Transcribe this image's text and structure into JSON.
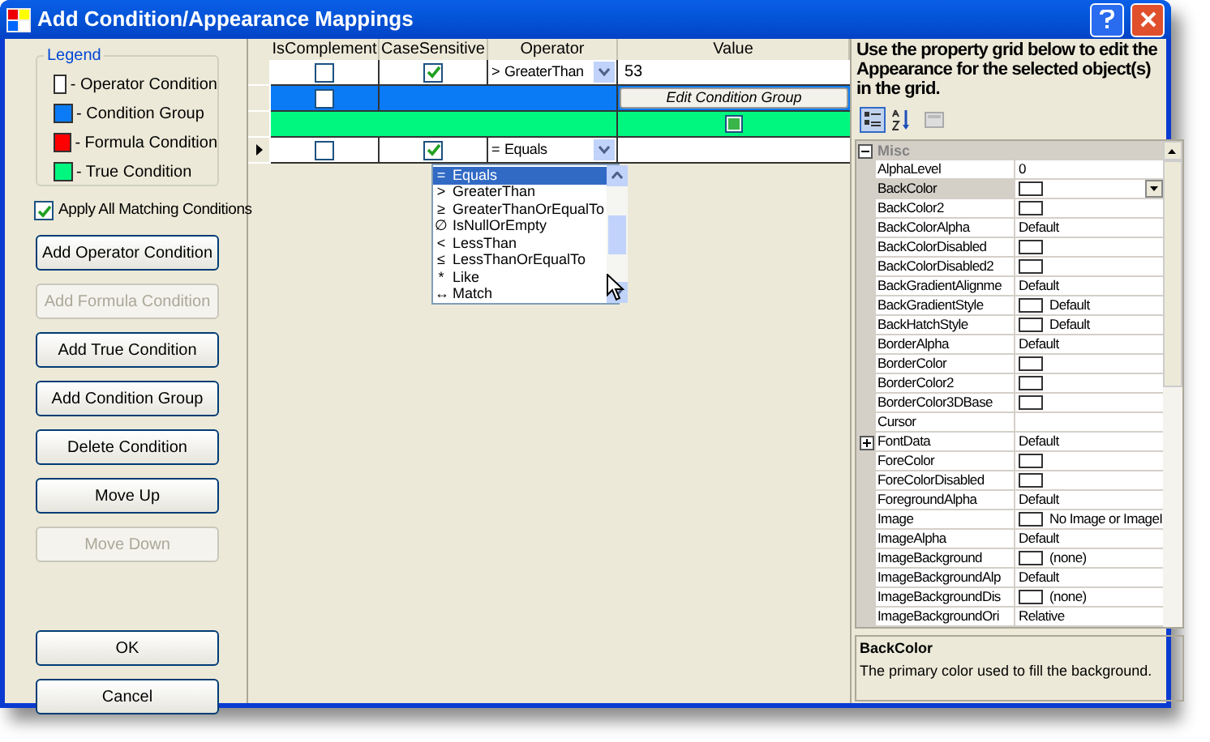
{
  "window": {
    "title": "Add Condition/Appearance Mappings"
  },
  "legend": {
    "title": "Legend",
    "items": [
      {
        "label": "- Operator Condition",
        "color": "#ffffff"
      },
      {
        "label": "- Condition Group",
        "color": "#0a7bf5"
      },
      {
        "label": "- Formula Condition",
        "color": "#ff0000"
      },
      {
        "label": "- True Condition",
        "color": "#00f77f"
      }
    ]
  },
  "apply_all": {
    "label": "Apply All Matching Conditions",
    "checked": true
  },
  "buttons": [
    {
      "label": "Add Operator Condition",
      "disabled": false,
      "kind": "action"
    },
    {
      "label": "Add Formula Condition",
      "disabled": true,
      "kind": "action"
    },
    {
      "label": "Add True Condition",
      "disabled": false,
      "kind": "action"
    },
    {
      "label": "Add Condition Group",
      "disabled": false,
      "kind": "action"
    },
    {
      "label": "Delete Condition",
      "disabled": false,
      "kind": "action"
    },
    {
      "label": "Move Up",
      "disabled": false,
      "kind": "action"
    },
    {
      "label": "Move Down",
      "disabled": true,
      "kind": "action"
    },
    {
      "label": "OK",
      "disabled": false,
      "kind": "dialog"
    },
    {
      "label": "Cancel",
      "disabled": false,
      "kind": "dialog"
    }
  ],
  "grid": {
    "columns": [
      "IsComplement",
      "CaseSensitive",
      "Operator",
      "Value"
    ],
    "rows": [
      {
        "kind": "operator",
        "current": false,
        "is_complement": false,
        "case_sensitive": true,
        "symbol": ">",
        "operator": "GreaterThan",
        "value": "53"
      },
      {
        "kind": "group",
        "current": false,
        "is_complement": false,
        "button": "Edit Condition Group"
      },
      {
        "kind": "true",
        "current": false,
        "checked": true
      },
      {
        "kind": "operator",
        "current": true,
        "is_complement": false,
        "case_sensitive": true,
        "symbol": "=",
        "operator": "Equals"
      }
    ]
  },
  "operator_dropdown": {
    "items": [
      {
        "symbol": "=",
        "label": "Equals",
        "selected": true
      },
      {
        "symbol": ">",
        "label": "GreaterThan",
        "selected": false
      },
      {
        "symbol": "≥",
        "label": "GreaterThanOrEqualTo",
        "selected": false
      },
      {
        "symbol": "∅",
        "label": "IsNullOrEmpty",
        "selected": false
      },
      {
        "symbol": "<",
        "label": "LessThan",
        "selected": false
      },
      {
        "symbol": "≤",
        "label": "LessThanOrEqualTo",
        "selected": false
      },
      {
        "symbol": "*",
        "label": "Like",
        "selected": false
      },
      {
        "symbol": "↔",
        "label": "Match",
        "selected": false
      }
    ]
  },
  "property_panel": {
    "instructions": "Use the property grid below to edit the Appearance for the selected object(s) in the grid.",
    "category": "Misc",
    "properties": [
      {
        "name": "AlphaLevel",
        "kind": "text",
        "value": "0",
        "selected": false,
        "expandable": false
      },
      {
        "name": "BackColor",
        "kind": "color",
        "selected": true,
        "expandable": false
      },
      {
        "name": "BackColor2",
        "kind": "color",
        "selected": false,
        "expandable": false
      },
      {
        "name": "BackColorAlpha",
        "kind": "text",
        "value": "Default",
        "selected": false,
        "expandable": false
      },
      {
        "name": "BackColorDisabled",
        "kind": "color",
        "selected": false,
        "expandable": false
      },
      {
        "name": "BackColorDisabled2",
        "kind": "color",
        "selected": false,
        "expandable": false
      },
      {
        "name": "BackGradientAlignme",
        "kind": "text",
        "value": "Default",
        "selected": false,
        "expandable": false
      },
      {
        "name": "BackGradientStyle",
        "kind": "swatch_text",
        "value": "Default",
        "selected": false,
        "expandable": false
      },
      {
        "name": "BackHatchStyle",
        "kind": "swatch_text",
        "value": "Default",
        "selected": false,
        "expandable": false
      },
      {
        "name": "BorderAlpha",
        "kind": "text",
        "value": "Default",
        "selected": false,
        "expandable": false
      },
      {
        "name": "BorderColor",
        "kind": "color",
        "selected": false,
        "expandable": false
      },
      {
        "name": "BorderColor2",
        "kind": "color",
        "selected": false,
        "expandable": false
      },
      {
        "name": "BorderColor3DBase",
        "kind": "color",
        "selected": false,
        "expandable": false
      },
      {
        "name": "Cursor",
        "kind": "text",
        "selected": false,
        "expandable": false
      },
      {
        "name": "FontData",
        "kind": "text",
        "value": "Default",
        "selected": false,
        "expandable": true
      },
      {
        "name": "ForeColor",
        "kind": "color",
        "selected": false,
        "expandable": false
      },
      {
        "name": "ForeColorDisabled",
        "kind": "color",
        "selected": false,
        "expandable": false
      },
      {
        "name": "ForegroundAlpha",
        "kind": "text",
        "value": "Default",
        "selected": false,
        "expandable": false
      },
      {
        "name": "Image",
        "kind": "swatch_text",
        "value": "No Image or ImageI",
        "selected": false,
        "expandable": false
      },
      {
        "name": "ImageAlpha",
        "kind": "text",
        "value": "Default",
        "selected": false,
        "expandable": false
      },
      {
        "name": "ImageBackground",
        "kind": "swatch_text",
        "value": "(none)",
        "selected": false,
        "expandable": false
      },
      {
        "name": "ImageBackgroundAlp",
        "kind": "text",
        "value": "Default",
        "selected": false,
        "expandable": false
      },
      {
        "name": "ImageBackgroundDis",
        "kind": "swatch_text",
        "value": "(none)",
        "selected": false,
        "expandable": false
      },
      {
        "name": "ImageBackgroundOri",
        "kind": "text",
        "value": "Relative",
        "selected": false,
        "expandable": false
      }
    ],
    "description": {
      "title": "BackColor",
      "text": "The primary color used to fill the background."
    }
  }
}
